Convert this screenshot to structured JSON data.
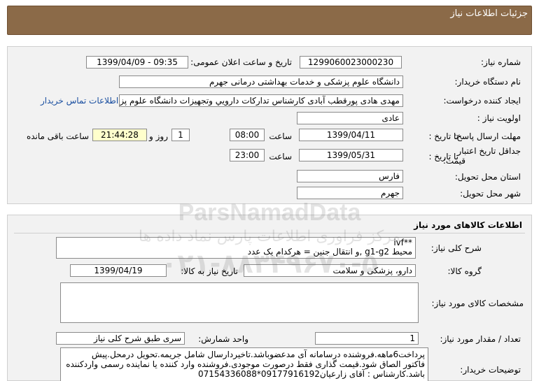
{
  "header": {
    "title": "جزئیات اطلاعات نیاز"
  },
  "fields": {
    "need_number_label": "شماره نیاز:",
    "need_number": "1299060023000230",
    "announce_label": "تاریخ و ساعت اعلان عمومی:",
    "announce_value": "1399/04/09 - 09:35",
    "buyer_label": "نام دستگاه خریدار:",
    "buyer_value": "دانشگاه علوم پزشکی و خدمات بهداشتی درمانی جهرم",
    "creator_label": "ایجاد کننده درخواست:",
    "creator_value": "مهدی هادی پورقطب آبادی کارشناس تداركات دارويي وتجهيزات دانشگاه علوم پز",
    "contact_link": "اطلاعات تماس خریدار",
    "priority_label": "اولویت نیاز :",
    "priority_value": "عادی",
    "deadline_label": "مهلت ارسال پاسخ:",
    "to_date_label": "تا تاریخ :",
    "deadline_date": "1399/04/11",
    "time_label": "ساعت",
    "deadline_time": "08:00",
    "days_value": "1",
    "days_label": "روز و",
    "remaining_time": "21:44:28",
    "remaining_label": "ساعت باقی مانده",
    "validity_label_1": "جداقل تاریخ اعتبار",
    "validity_label_2": "قیمت:",
    "validity_to_label": "تا تاریخ :",
    "validity_date": "1399/05/31",
    "validity_time_label": "ساعت",
    "validity_time": "23:00",
    "province_label": "استان محل تحویل:",
    "province_value": "فارس",
    "city_label": "شهر محل تحویل:",
    "city_value": "جهرم"
  },
  "goods": {
    "section_title": "اطلاعات کالاهای مورد نیاز",
    "desc_label": "شرح کلی نیاز:",
    "desc_line1": "**ivf",
    "desc_line2": "محیط g1-g2 ,و انتقال جنین = هرکدام یک عدد",
    "group_label": "گروه کالا:",
    "group_value": "دارو، پزشکی و سلامت",
    "need_date_label": "تاریخ نیاز به کالا:",
    "need_date": "1399/04/19",
    "specs_label": "مشخصات کالای مورد نیاز:",
    "specs_value": "",
    "quantity_label": "تعداد / مقدار مورد نیاز:",
    "quantity_value": "1",
    "unit_label": "واحد شمارش:",
    "unit_value": "سری طبق شرح کلی نیاز",
    "buyer_notes_label": "توضیحات خریدار:",
    "buyer_notes_line1": "پرداخت6ماهه.فروشنده درسامانه آی مدعضوباشد.تاخیردارسال شامل جریمه.تحویل درمحل.پیش",
    "buyer_notes_line2": "فاکتور الصاق شود.قیمت گذاری فقط درصورت موجودی.فروشنده وارد کننده یا نماینده رسمی واردکننده",
    "buyer_notes_line3": "باشد.کارشناس : آقای زارعیان09177916192*07154336088"
  },
  "watermark": {
    "line1": "ParsNamadData",
    "line2": "مرکز فراوری اطلاعات پارس نماد داده ها",
    "line3": "۰۲۱-۸۸۳۴۹۶۷۰-۵"
  },
  "colors": {
    "header": "#8b6a48",
    "highlight": "#ffffcc",
    "link": "#1a4fa0"
  }
}
